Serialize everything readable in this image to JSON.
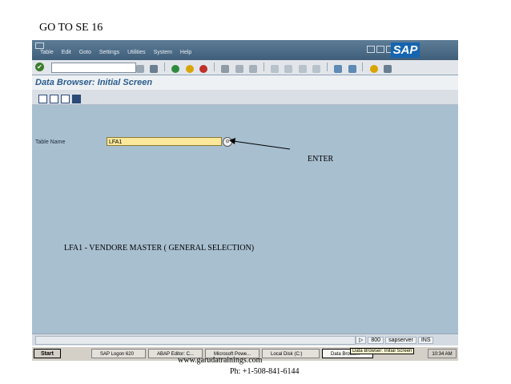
{
  "slide": {
    "title": "GO TO SE 16",
    "annotation": "ENTER",
    "description": "LFA1  - VENDORE MASTER ( GENERAL SELECTION)",
    "website": "www.garudatrainings.com",
    "phone": "Ph: +1-508-841-6144"
  },
  "menubar": {
    "items": [
      "Table",
      "Edit",
      "Goto",
      "Settings",
      "Utilities",
      "System",
      "Help"
    ],
    "logo": "SAP"
  },
  "toolbar": {
    "enter_icon": "check-icon"
  },
  "screen": {
    "title": "Data Browser: Initial Screen",
    "table_name_label": "Table Name",
    "table_name_value": "LFA1"
  },
  "statusbar": {
    "client": "800",
    "server": "sapserver",
    "mode": "INS"
  },
  "taskbar": {
    "start": "Start",
    "items": [
      "SAP Logon 620",
      "ABAP Editor: C...",
      "Microsoft Powe...",
      "Local Disk (C:)",
      "Data Brows..."
    ],
    "time": "10:34 AM",
    "tooltip": "Data Browser: Initial Screen"
  }
}
